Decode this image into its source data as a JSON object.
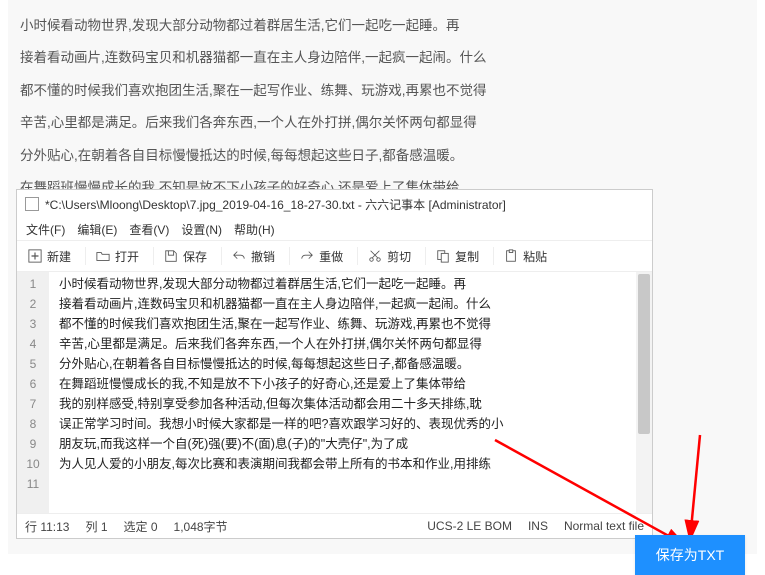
{
  "bg_text": [
    "小时候看动物世界,发现大部分动物都过着群居生活,它们一起吃一起睡。再",
    "接着看动画片,连数码宝贝和机器猫都一直在主人身边陪伴,一起疯一起闹。什么",
    "都不懂的时候我们喜欢抱团生活,聚在一起写作业、练舞、玩游戏,再累也不觉得",
    "辛苦,心里都是满足。后来我们各奔东西,一个人在外打拼,偶尔关怀两句都显得",
    "分外贴心,在朝着各自目标慢慢抵达的时候,每每想起这些日子,都备感温暖。",
    "在舞蹈班慢慢成长的我,不知是放不下小孩子的好奇心,还是爱上了集体带给"
  ],
  "notepad": {
    "title": "*C:\\Users\\Mloong\\Desktop\\7.jpg_2019-04-16_18-27-30.txt - 六六记事本 [Administrator]",
    "menu": {
      "file": "文件(F)",
      "edit": "编辑(E)",
      "view": "查看(V)",
      "settings": "设置(N)",
      "help": "帮助(H)"
    },
    "toolbar": {
      "new": "新建",
      "open": "打开",
      "save": "保存",
      "undo": "撤销",
      "redo": "重做",
      "cut": "剪切",
      "copy": "复制",
      "paste": "粘贴"
    },
    "lines": [
      "小时候看动物世界,发现大部分动物都过着群居生活,它们一起吃一起睡。再",
      "接着看动画片,连数码宝贝和机器猫都一直在主人身边陪伴,一起疯一起闹。什么",
      "都不懂的时候我们喜欢抱团生活,聚在一起写作业、练舞、玩游戏,再累也不觉得",
      "辛苦,心里都是满足。后来我们各奔东西,一个人在外打拼,偶尔关怀两句都显得",
      "分外贴心,在朝着各自目标慢慢抵达的时候,每每想起这些日子,都备感温暖。",
      "在舞蹈班慢慢成长的我,不知是放不下小孩子的好奇心,还是爱上了集体带给",
      "我的别样感受,特别享受参加各种活动,但每次集体活动都会用二十多天排练,耽",
      "误正常学习时间。我想小时候大家都是一样的吧?喜欢跟学习好的、表现优秀的小",
      "朋友玩,而我这样一个自(死)强(要)不(面)息(子)的\"大壳仔\",为了成",
      "为人见人爱的小朋友,每次比赛和表演期间我都会带上所有的书本和作业,用排练"
    ],
    "status": {
      "line": "行 11:13",
      "col": "列  1",
      "sel": "选定  0",
      "bytes": "1,048字节",
      "enc": "UCS-2 LE BOM",
      "ins": "INS",
      "mode": "Normal text file"
    }
  },
  "save_btn": "保存为TXT"
}
